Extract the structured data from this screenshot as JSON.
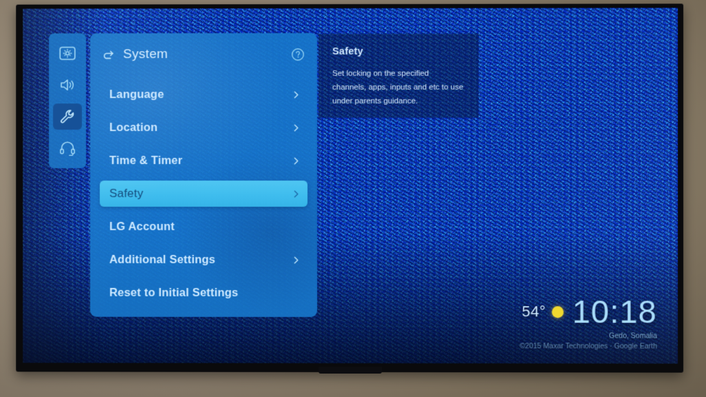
{
  "device": {
    "name": "lg-tv",
    "wall_color": "#a3937c",
    "bezel_color": "#0a0a0c"
  },
  "wallpaper": {
    "name": "satellite-aerial-wallpaper",
    "dominant_colors": [
      "#1e7fd0",
      "#0b2f6e",
      "#8fd6f5"
    ]
  },
  "sidebar": {
    "items": [
      {
        "icon": "picture-settings-icon",
        "label": "Picture",
        "selected": false
      },
      {
        "icon": "sound-settings-icon",
        "label": "Sound",
        "selected": false
      },
      {
        "icon": "general-settings-wrench-icon",
        "label": "General",
        "selected": true
      },
      {
        "icon": "support-headset-icon",
        "label": "Support",
        "selected": false
      }
    ]
  },
  "panel": {
    "back_icon": "back-arrow-icon",
    "title": "System",
    "help_icon": "help-circle-icon",
    "accent_color": "#3fbdee",
    "background_color": "#1778cb",
    "items": [
      {
        "label": "Language",
        "has_chevron": true,
        "selected": false
      },
      {
        "label": "Location",
        "has_chevron": true,
        "selected": false
      },
      {
        "label": "Time & Timer",
        "has_chevron": true,
        "selected": false
      },
      {
        "label": "Safety",
        "has_chevron": true,
        "selected": true
      },
      {
        "label": "LG Account",
        "has_chevron": false,
        "selected": false
      },
      {
        "label": "Additional Settings",
        "has_chevron": true,
        "selected": false
      },
      {
        "label": "Reset to Initial Settings",
        "has_chevron": false,
        "selected": false
      }
    ]
  },
  "description": {
    "title": "Safety",
    "body": "Set locking on the specified channels, apps, inputs and etc to use under parents guidance."
  },
  "clock_widget": {
    "temperature": "54°",
    "weather_icon": "sunny-icon",
    "weather_icon_color": "#f0d92e",
    "time": "10:18"
  },
  "attribution": {
    "location": "Gedo, Somalia",
    "credit": "©2015 Maxar Technologies · Google Earth"
  }
}
